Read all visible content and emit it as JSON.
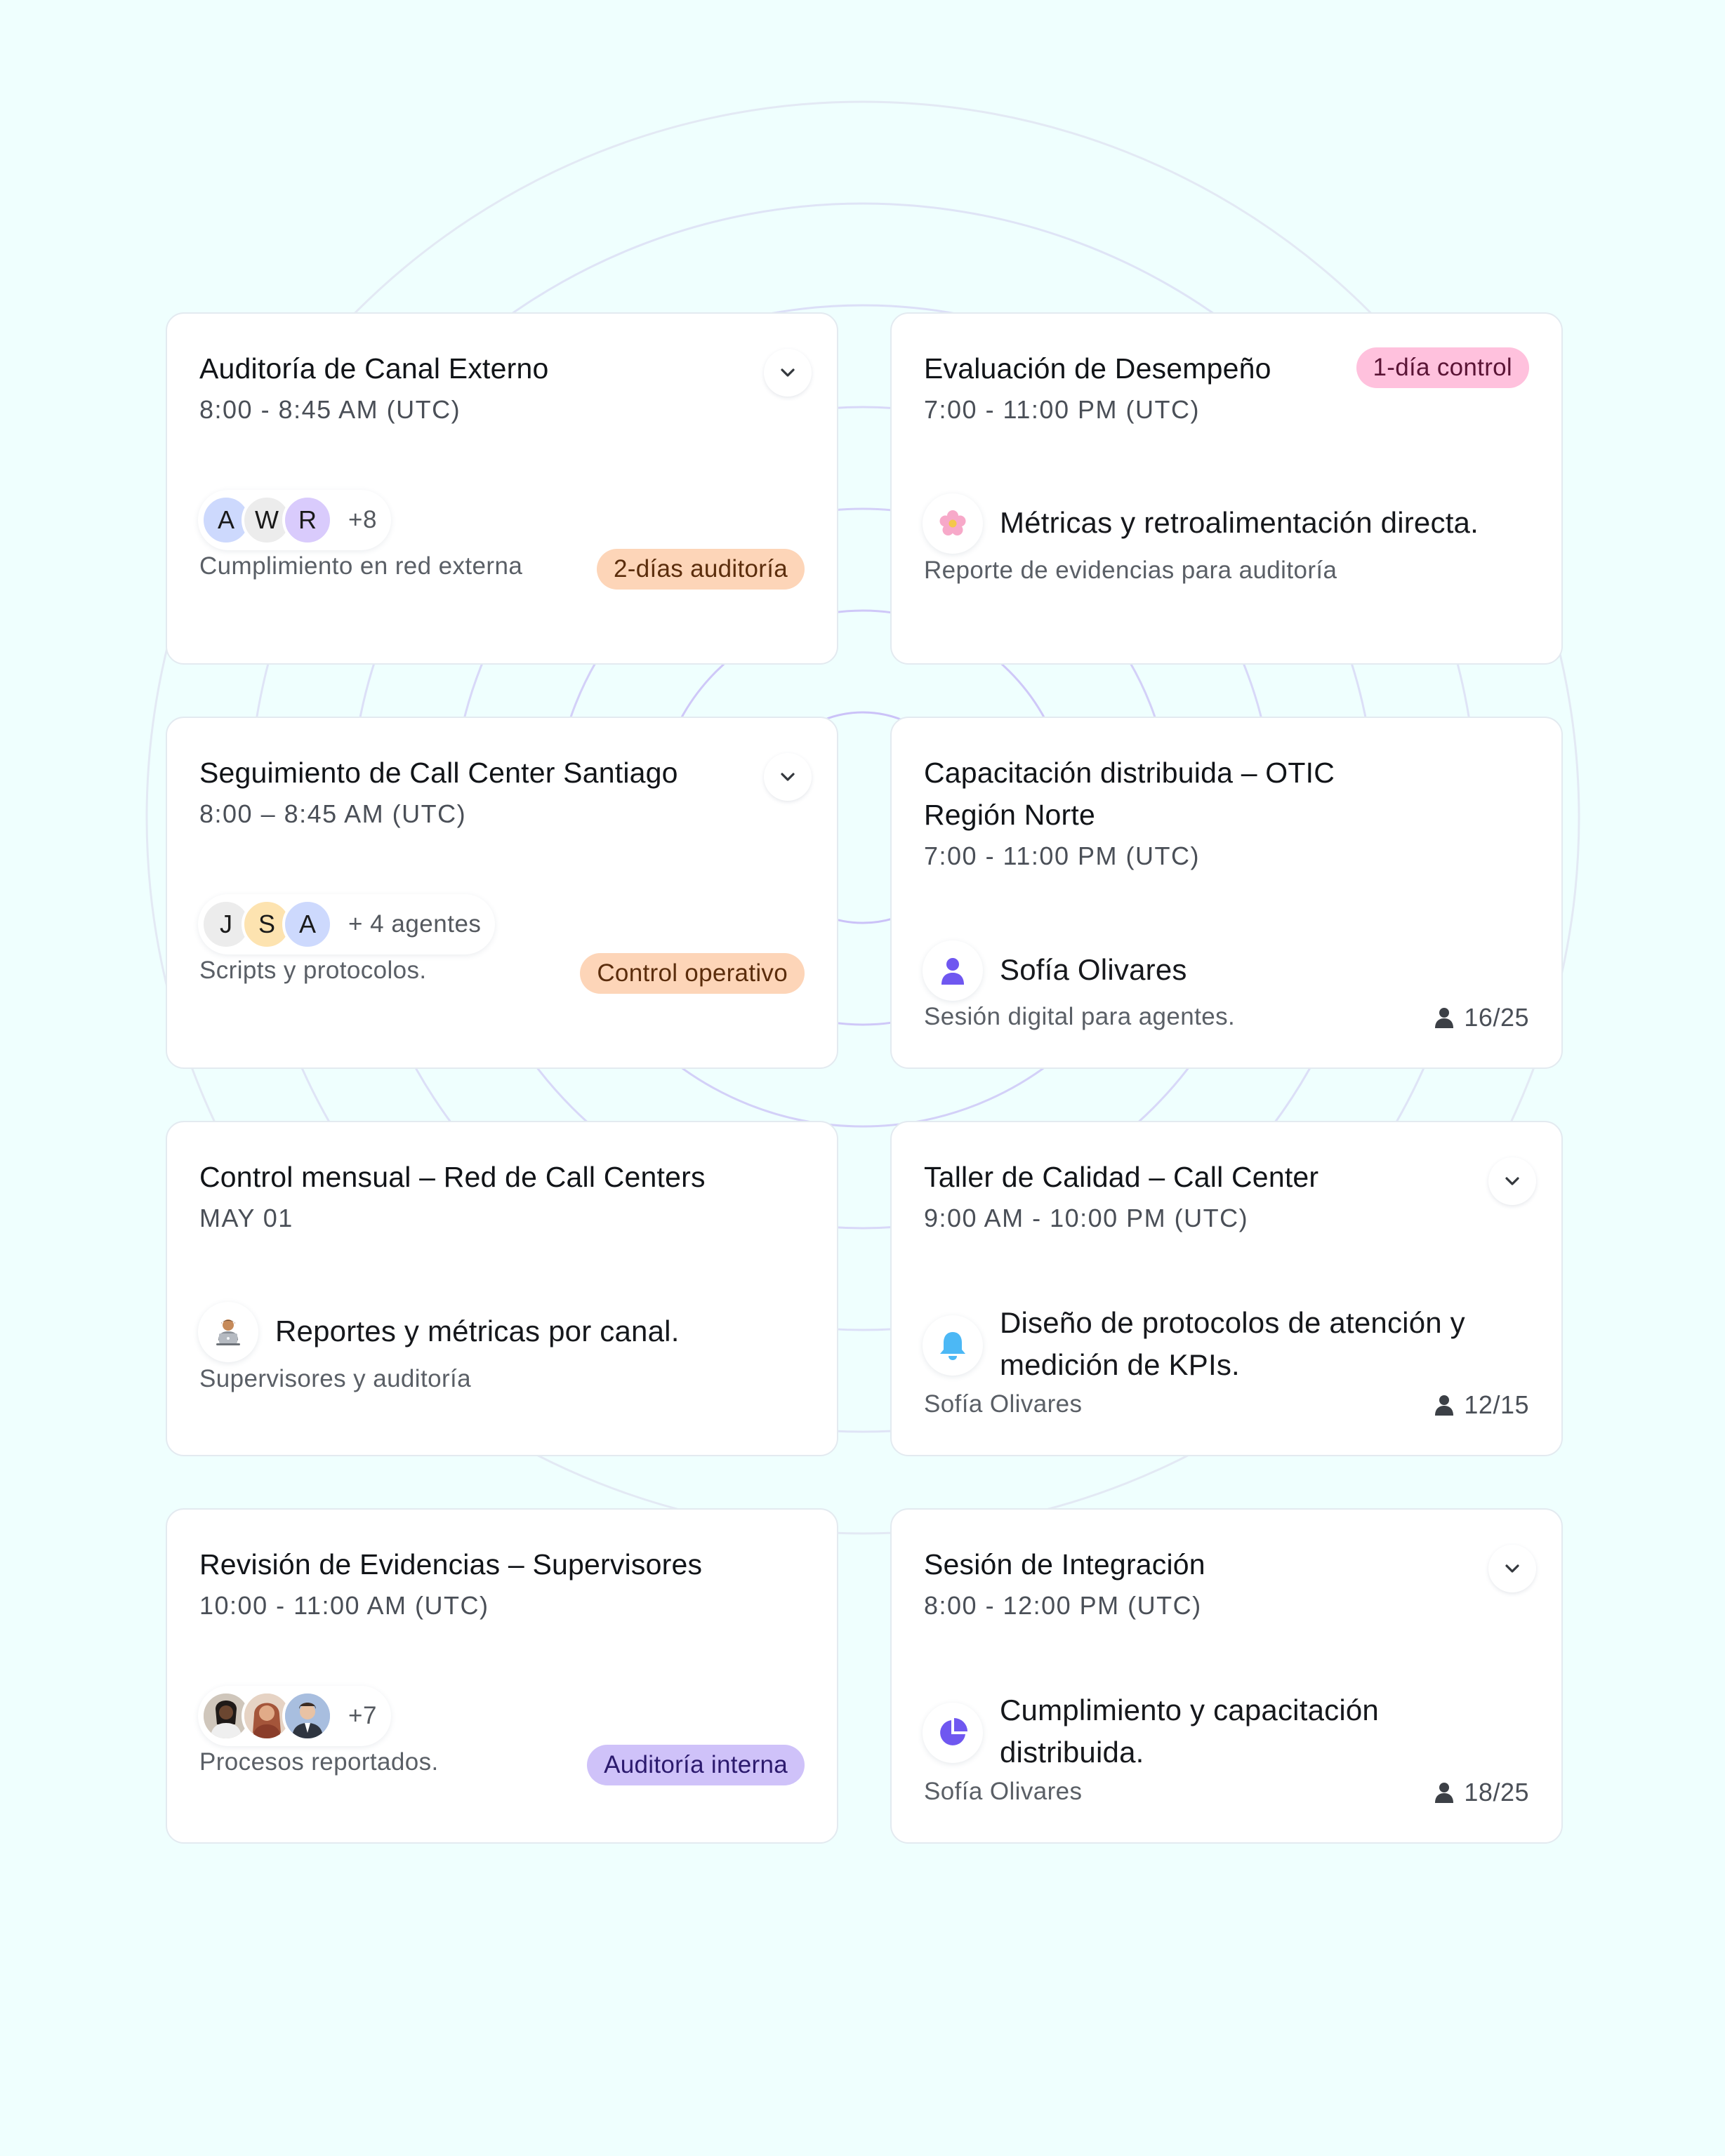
{
  "colors": {
    "background": "#effffe",
    "tag_peach": "#fdd5b8",
    "tag_pink": "#ffc1dd",
    "tag_purple": "#cfc2f9",
    "avatar_blue": "#cdd9fd",
    "avatar_gray": "#ececec",
    "avatar_purple": "#d9cbfc",
    "avatar_yellow": "#fde3b0",
    "accent_purple": "#6f57f0",
    "accent_blue": "#4cb8f5"
  },
  "cards": [
    {
      "title": "Auditoría de Canal Externo",
      "time": "8:00 - 8:45 AM (UTC)",
      "avatars": [
        "A",
        "W",
        "R"
      ],
      "more": "+8",
      "footer": "Cumplimiento en red externa",
      "tag": "2-días auditoría"
    },
    {
      "title": "Evaluación de Desempeño",
      "tag": "1-día control",
      "time": "7:00 - 11:00 PM (UTC)",
      "icon": "flower-icon",
      "main": "Métricas y retroalimentación directa.",
      "footer": "Reporte de evidencias para auditoría"
    },
    {
      "title": "Seguimiento de Call Center Santiago",
      "time": "8:00 – 8:45 AM (UTC)",
      "avatars": [
        "J",
        "S",
        "A"
      ],
      "more": "+ 4 agentes",
      "footer": "Scripts y protocolos.",
      "tag": "Control operativo"
    },
    {
      "title_line1": "Capacitación distribuida – OTIC",
      "title_line2": "Región Norte",
      "time": "7:00 - 11:00 PM (UTC)",
      "icon": "person-icon",
      "main": "Sofía Olivares",
      "footer": "Sesión digital para agentes.",
      "count": "16/25"
    },
    {
      "title": "Control mensual – Red de Call Centers",
      "time": "MAY 01",
      "icon": "person-at-computer-icon",
      "main": "Reportes y métricas por canal.",
      "footer": "Supervisores y auditoría"
    },
    {
      "title": "Taller de Calidad – Call Center",
      "time": "9:00 AM - 10:00 PM (UTC)",
      "icon": "bell-icon",
      "main_line1": "Diseño de protocolos de atención y",
      "main_line2": "medición de KPIs.",
      "footer": "Sofía Olivares",
      "count": "12/15"
    },
    {
      "title": "Revisión de Evidencias – Supervisores",
      "time": "10:00 - 11:00 AM (UTC)",
      "avatars": [
        "photo-avatar-1",
        "photo-avatar-2",
        "photo-avatar-3"
      ],
      "more": "+7",
      "footer": "Procesos reportados.",
      "tag": "Auditoría interna"
    },
    {
      "title": "Sesión de Integración",
      "time": "8:00 - 12:00 PM (UTC)",
      "icon": "pie-chart-icon",
      "main_line1": "Cumplimiento y capacitación",
      "main_line2": "distribuida.",
      "footer": "Sofía Olivares",
      "count": "18/25"
    }
  ]
}
